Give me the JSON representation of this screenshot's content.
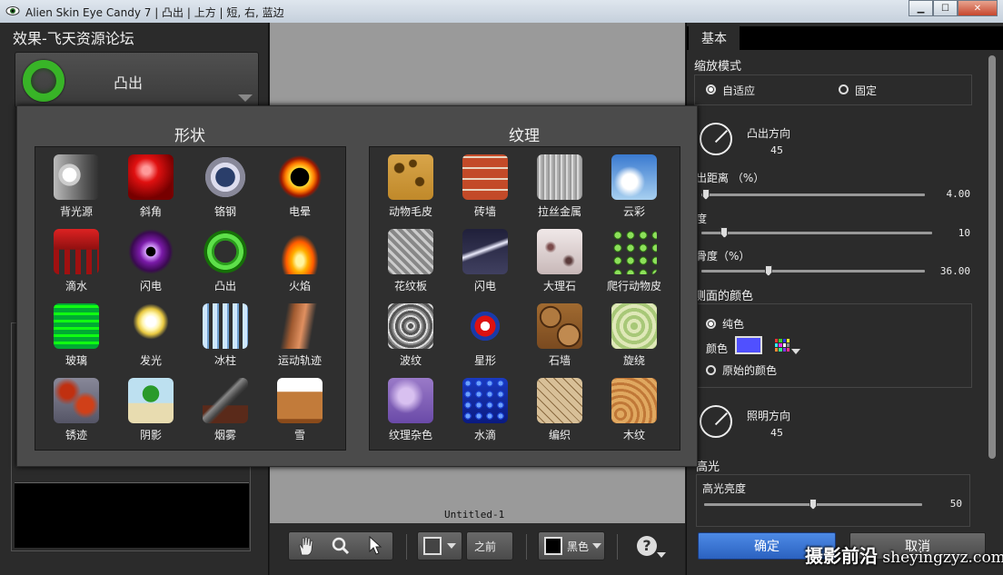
{
  "window": {
    "title": "Alien Skin Eye Candy 7 | 凸出 | 上方 | 短, 右, 蓝边",
    "minimize": "▁",
    "maximize": "☐",
    "close": "✕"
  },
  "left_panel": {
    "title": "效果-飞天资源论坛",
    "selected_preset": "凸出"
  },
  "canvas": {
    "document_name": "Untitled-1"
  },
  "toolbar": {
    "before_label": "之前",
    "bg_color_label": "黑色",
    "help_label": "?"
  },
  "popup": {
    "shapes_title": "形状",
    "textures_title": "纹理",
    "shapes": [
      {
        "label": "背光源",
        "icon": "backlight-icon"
      },
      {
        "label": "斜角",
        "icon": "bevel-icon"
      },
      {
        "label": "铬钢",
        "icon": "chrome-icon"
      },
      {
        "label": "电晕",
        "icon": "corona-icon"
      },
      {
        "label": "滴水",
        "icon": "drip-icon"
      },
      {
        "label": "闪电",
        "icon": "lightning-icon"
      },
      {
        "label": "凸出",
        "icon": "extrude-icon"
      },
      {
        "label": "火焰",
        "icon": "fire-icon"
      },
      {
        "label": "玻璃",
        "icon": "glass-icon"
      },
      {
        "label": "发光",
        "icon": "glow-icon"
      },
      {
        "label": "冰柱",
        "icon": "icicles-icon"
      },
      {
        "label": "运动轨迹",
        "icon": "motion-trail-icon"
      },
      {
        "label": "锈迹",
        "icon": "rust-icon"
      },
      {
        "label": "阴影",
        "icon": "shadow-icon"
      },
      {
        "label": "烟雾",
        "icon": "smoke-icon"
      },
      {
        "label": "雪",
        "icon": "snow-icon"
      }
    ],
    "textures": [
      {
        "label": "动物毛皮",
        "icon": "animal-fur-icon"
      },
      {
        "label": "砖墙",
        "icon": "brick-wall-icon"
      },
      {
        "label": "拉丝金属",
        "icon": "brushed-metal-icon"
      },
      {
        "label": "云彩",
        "icon": "clouds-icon"
      },
      {
        "label": "花纹板",
        "icon": "diamond-plate-icon"
      },
      {
        "label": "闪电",
        "icon": "texture-lightning-icon"
      },
      {
        "label": "大理石",
        "icon": "marble-icon"
      },
      {
        "label": "爬行动物皮",
        "icon": "reptile-skin-icon"
      },
      {
        "label": "波纹",
        "icon": "ripples-icon"
      },
      {
        "label": "星形",
        "icon": "stars-icon"
      },
      {
        "label": "石墙",
        "icon": "stone-wall-icon"
      },
      {
        "label": "旋绕",
        "icon": "swirl-icon"
      },
      {
        "label": "纹理杂色",
        "icon": "texture-noise-icon"
      },
      {
        "label": "水滴",
        "icon": "water-drops-icon"
      },
      {
        "label": "编织",
        "icon": "weave-icon"
      },
      {
        "label": "木纹",
        "icon": "wood-icon"
      }
    ]
  },
  "right_panel": {
    "tab_basic": "基本",
    "zoom_mode_label": "缩放模式",
    "zoom_adaptive": "自适应",
    "zoom_fixed": "固定",
    "extrude_direction_label": "凸出方向",
    "extrude_direction_value": "45",
    "extrude_distance_label": "出距离 （%）",
    "extrude_distance_value": "4.00",
    "extrude_distance_level": 0.02,
    "bevel_width_label": "度",
    "bevel_width_value": "10",
    "bevel_width_level": 0.1,
    "smoothness_label": "骨度（%）",
    "smoothness_value": "36.00",
    "smoothness_level": 0.3,
    "side_color_label": "侧面的颜色",
    "solid_color": "纯色",
    "color_label": "颜色",
    "color_value": "#5050ff",
    "original_color": "原始的颜色",
    "light_direction_label": "照明方向",
    "light_direction_value": "45",
    "highlight_label": "高光",
    "highlight_brightness_label": "高光亮度",
    "highlight_brightness_value": "50",
    "highlight_brightness_level": 0.5,
    "ok_label": "确定",
    "cancel_label": "取消"
  },
  "watermark": {
    "cn": "摄影前沿",
    "latin": " sheyingzyz.com"
  }
}
